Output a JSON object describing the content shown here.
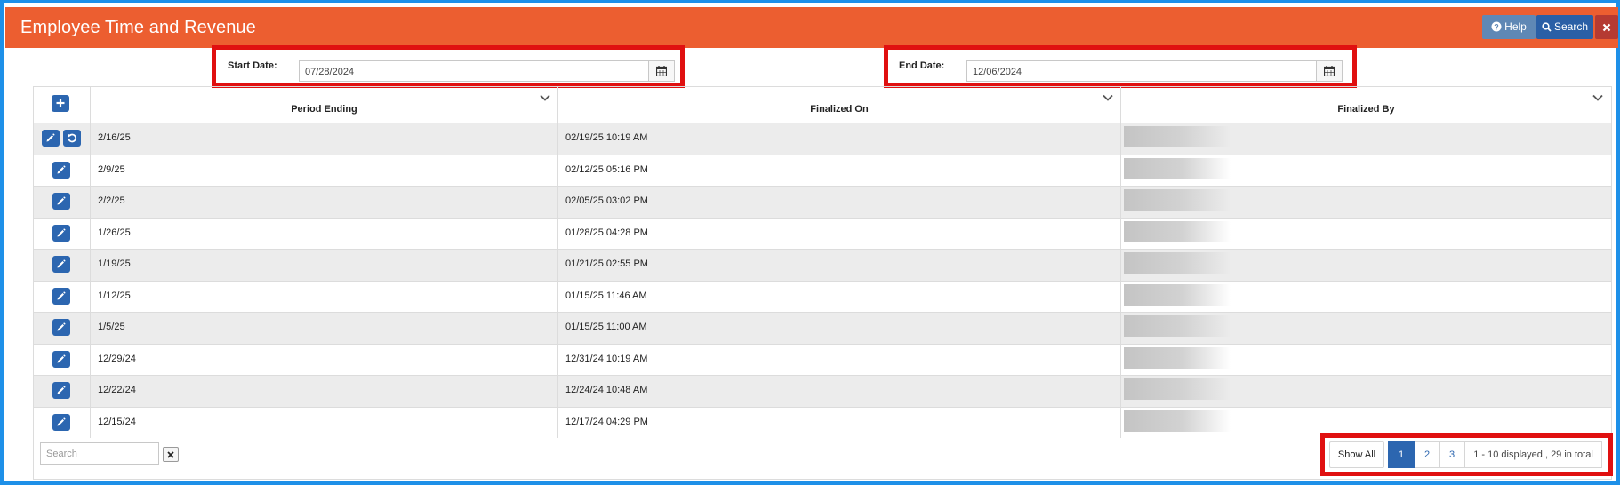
{
  "app": {
    "title": "Employee Time and Revenue",
    "help_label": "Help",
    "search_label": "Search",
    "accent_color": "#ec5e30"
  },
  "filters": {
    "start_label": "Start Date:",
    "start_value": "07/28/2024",
    "end_label": "End Date:",
    "end_value": "12/06/2024"
  },
  "table": {
    "columns": [
      "Period Ending",
      "Finalized On",
      "Finalized By"
    ],
    "rows": [
      {
        "period": "2/16/25",
        "finalized_on": "02/19/25 10:19 AM"
      },
      {
        "period": "2/9/25",
        "finalized_on": "02/12/25 05:16 PM"
      },
      {
        "period": "2/2/25",
        "finalized_on": "02/05/25 03:02 PM"
      },
      {
        "period": "1/26/25",
        "finalized_on": "01/28/25 04:28 PM"
      },
      {
        "period": "1/19/25",
        "finalized_on": "01/21/25 02:55 PM"
      },
      {
        "period": "1/12/25",
        "finalized_on": "01/15/25 11:46 AM"
      },
      {
        "period": "1/5/25",
        "finalized_on": "01/15/25 11:00 AM"
      },
      {
        "period": "12/29/24",
        "finalized_on": "12/31/24 10:19 AM"
      },
      {
        "period": "12/22/24",
        "finalized_on": "12/24/24 10:48 AM"
      },
      {
        "period": "12/15/24",
        "finalized_on": "12/17/24 04:29 PM"
      }
    ]
  },
  "footer": {
    "search_placeholder": "Search",
    "show_all_label": "Show All",
    "pages": [
      "1",
      "2",
      "3"
    ],
    "active_page": "1",
    "summary": "1 - 10 displayed , 29 in total"
  }
}
